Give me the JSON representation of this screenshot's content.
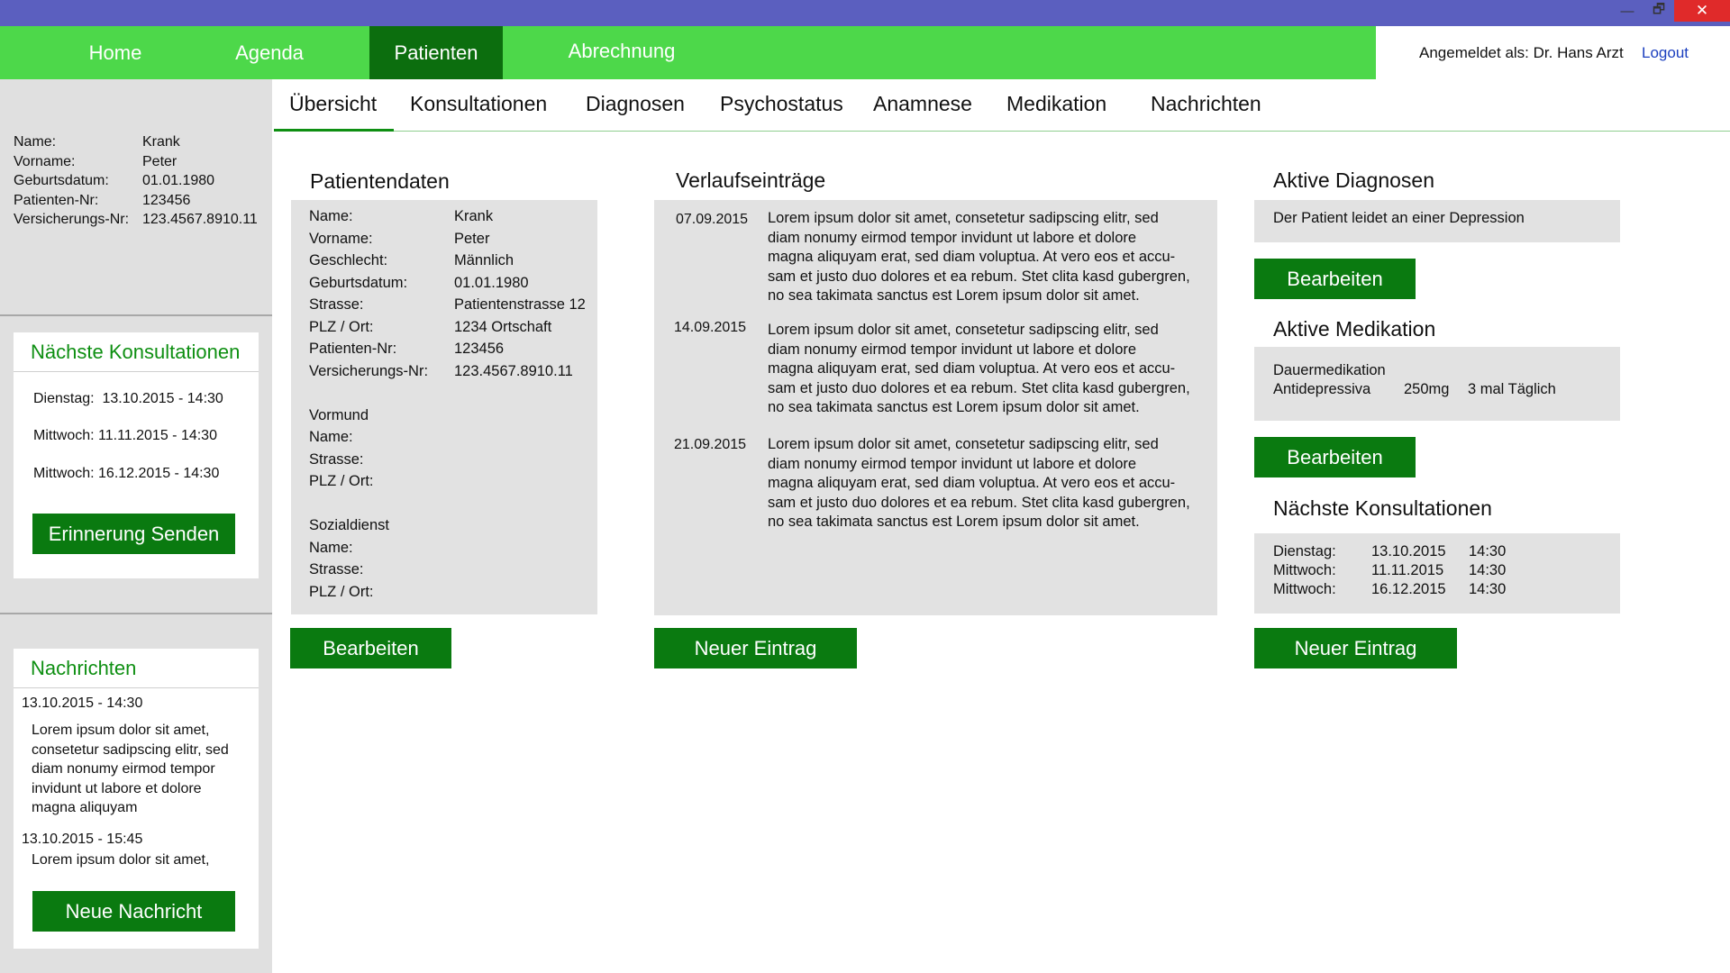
{
  "window": {
    "minimize": "—",
    "maximize": "🗗",
    "close": "✕"
  },
  "nav": {
    "home": "Home",
    "agenda": "Agenda",
    "patienten": "Patienten",
    "abrechnung": "Abrechnung"
  },
  "user": {
    "logged_in": "Angemeldet als: Dr. Hans Arzt",
    "logout": "Logout"
  },
  "sidebar": {
    "patient": [
      {
        "label": "Name:",
        "value": "Krank"
      },
      {
        "label": "Vorname:",
        "value": "Peter"
      },
      {
        "label": "Geburtsdatum:",
        "value": "01.01.1980"
      },
      {
        "label": "Patienten-Nr:",
        "value": "123456"
      },
      {
        "label": "Versicherungs-Nr:",
        "value": "123.4567.8910.11"
      }
    ],
    "next_consultations": {
      "title": "Nächste Konsultationen",
      "items": [
        "Dienstag:  13.10.2015 - 14:30",
        "Mittwoch: 11.11.2015 - 14:30",
        "Mittwoch: 16.12.2015 - 14:30"
      ],
      "button": "Erinnerung Senden"
    },
    "messages": {
      "title": "Nachrichten",
      "items": [
        {
          "date": "13.10.2015 - 14:30",
          "text": "Lorem ipsum dolor sit amet, consetetur sadipscing elitr, sed diam nonumy eirmod tempor invidunt ut labore et dolore magna aliquyam"
        },
        {
          "date": "13.10.2015 - 15:45",
          "text": "Lorem ipsum dolor sit amet,"
        }
      ],
      "button": "Neue Nachricht"
    }
  },
  "tabs": [
    "Übersicht",
    "Konsultationen",
    "Diagnosen",
    "Psychostatus",
    "Anamnese",
    "Medikation",
    "Nachrichten"
  ],
  "patientdata": {
    "title": "Patientendaten",
    "rows": [
      {
        "label": "Name:",
        "value": "Krank"
      },
      {
        "label": "Vorname:",
        "value": "Peter"
      },
      {
        "label": "Geschlecht:",
        "value": "Männlich"
      },
      {
        "label": "Geburtsdatum:",
        "value": "01.01.1980"
      },
      {
        "label": "Strasse:",
        "value": "Patientenstrasse 12"
      },
      {
        "label": "PLZ / Ort:",
        "value": "1234 Ortschaft"
      },
      {
        "label": "Patienten-Nr:",
        "value": "123456"
      },
      {
        "label": "Versicherungs-Nr:",
        "value": "123.4567.8910.11"
      }
    ],
    "guardian": {
      "title": "Vormund",
      "rows": [
        "Name:",
        "Strasse:",
        "PLZ / Ort:"
      ]
    },
    "social": {
      "title": "Sozialdienst",
      "rows": [
        "Name:",
        "Strasse:",
        "PLZ / Ort:"
      ]
    },
    "button": "Bearbeiten"
  },
  "history": {
    "title": "Verlaufseinträge",
    "entries": [
      {
        "date": "07.09.2015",
        "lines": [
          "Lorem ipsum dolor sit amet, consetetur sadipscing elitr, sed",
          "diam nonumy eirmod tempor invidunt ut labore et dolore",
          "magna aliquyam erat, sed diam voluptua. At vero eos et accu-",
          "sam et justo duo dolores et ea rebum. Stet clita kasd gubergren,",
          "no sea takimata sanctus est Lorem ipsum dolor sit amet."
        ]
      },
      {
        "date": "14.09.2015",
        "lines": [
          "Lorem ipsum dolor sit amet, consetetur sadipscing elitr, sed",
          "diam nonumy eirmod tempor invidunt ut labore et dolore",
          "magna aliquyam erat, sed diam voluptua. At vero eos et accu-",
          "sam et justo duo dolores et ea rebum. Stet clita kasd gubergren,",
          "no sea takimata sanctus est Lorem ipsum dolor sit amet."
        ]
      },
      {
        "date": "21.09.2015",
        "lines": [
          "Lorem ipsum dolor sit amet, consetetur sadipscing elitr, sed",
          "diam nonumy eirmod tempor invidunt ut labore et dolore",
          "magna aliquyam erat, sed diam voluptua. At vero eos et accu-",
          "sam et justo duo dolores et ea rebum. Stet clita kasd gubergren,",
          "no sea takimata sanctus est Lorem ipsum dolor sit amet."
        ]
      }
    ],
    "button": "Neuer Eintrag"
  },
  "diagnoses": {
    "title": "Aktive Diagnosen",
    "text": "Der Patient leidet an einer Depression",
    "button": "Bearbeiten"
  },
  "medication": {
    "title": "Aktive Medikation",
    "type": "Dauermedikation",
    "name": "Antidepressiva",
    "dose": "250mg",
    "frequency": "3 mal Täglich",
    "button": "Bearbeiten"
  },
  "consultations": {
    "title": "Nächste Konsultationen",
    "rows": [
      {
        "day": "Dienstag:",
        "date": "13.10.2015",
        "time": "14:30"
      },
      {
        "day": "Mittwoch:",
        "date": "11.11.2015",
        "time": "14:30"
      },
      {
        "day": "Mittwoch:",
        "date": "16.12.2015",
        "time": "14:30"
      }
    ],
    "button": "Neuer Eintrag"
  },
  "colors": {
    "titlebar": "#5b5fbf",
    "nav": "#4dd84a",
    "nav_active": "#0c6e0e",
    "button": "#0a7a10",
    "accent_text": "#0e8f12",
    "close": "#e02a2a"
  }
}
